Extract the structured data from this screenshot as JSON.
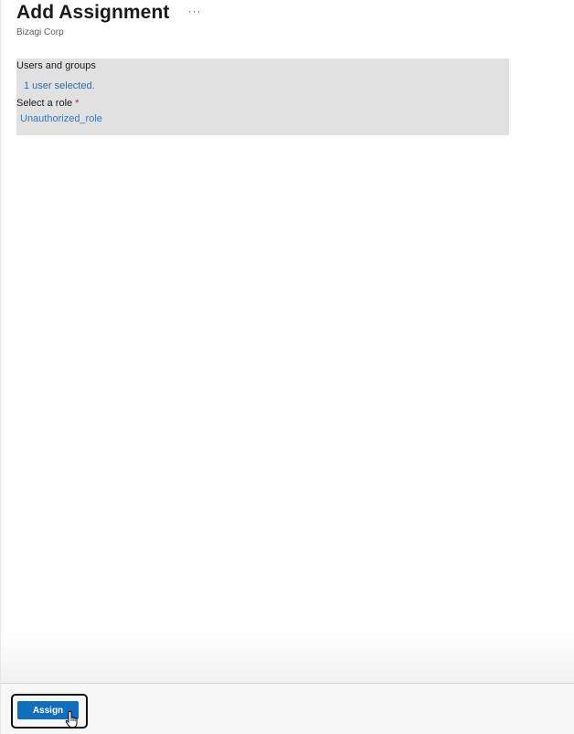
{
  "header": {
    "title": "Add Assignment",
    "more_label": "···",
    "subtitle": "Bizagi Corp"
  },
  "form": {
    "users_label": "Users and groups",
    "users_value": "1 user selected.",
    "role_label": "Select a role",
    "role_required": "*",
    "role_value": "Unauthorized_role"
  },
  "footer": {
    "assign_label": "Assign"
  },
  "colors": {
    "primary": "#106ebe",
    "link": "#2f7bbd",
    "required": "#a4262c",
    "section_bg": "#e1e1e1"
  }
}
